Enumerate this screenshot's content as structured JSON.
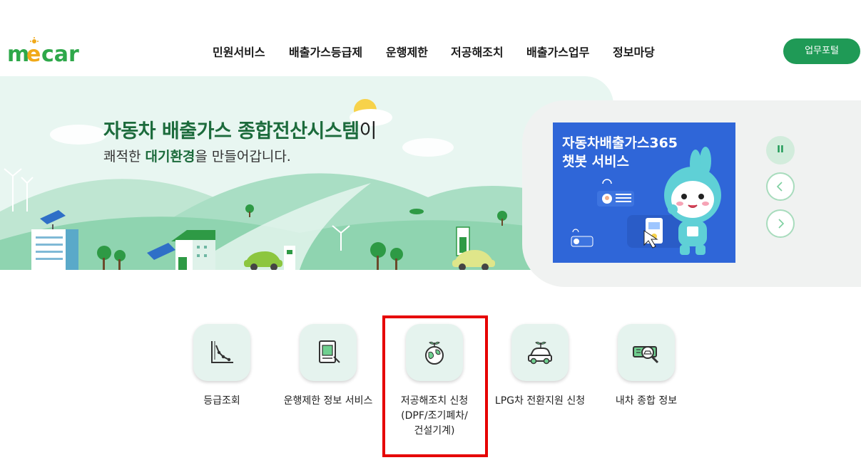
{
  "header": {
    "logo_text": "mecar",
    "nav": [
      {
        "label": "민원서비스"
      },
      {
        "label": "배출가스등급제"
      },
      {
        "label": "운행제한"
      },
      {
        "label": "저공해조치"
      },
      {
        "label": "배출가스업무"
      },
      {
        "label": "정보마당"
      }
    ],
    "portal_button": "업무포털"
  },
  "hero": {
    "title_part1": "자동차 배출가스 종합전산시스템",
    "title_part2": "이",
    "subtitle_plain1": "쾌적한 ",
    "subtitle_bold": "대기환경",
    "subtitle_plain2": "을 만들어갑니다."
  },
  "slider": {
    "slide_title_line1": "자동차배출가스365",
    "slide_title_line2": "챗봇 서비스",
    "pause_label": "II"
  },
  "quick_menu": [
    {
      "label_lines": [
        "등급조회"
      ],
      "icon": "chart-icon"
    },
    {
      "label_lines": [
        "운행제한 정보 서비스"
      ],
      "icon": "document-icon"
    },
    {
      "label_lines": [
        "저공해조치 신청",
        "(DPF/조기폐차/",
        "건설기계)"
      ],
      "icon": "eco-globe-icon"
    },
    {
      "label_lines": [
        "LPG차 전환지원 신청"
      ],
      "icon": "eco-car-icon"
    },
    {
      "label_lines": [
        "내차 종합 정보"
      ],
      "icon": "search-car-icon"
    }
  ],
  "colors": {
    "brand_green": "#1f9a56",
    "hero_bg": "#e8f6f1",
    "slide_blue": "#2f66d8",
    "highlight_red": "#e60000"
  }
}
